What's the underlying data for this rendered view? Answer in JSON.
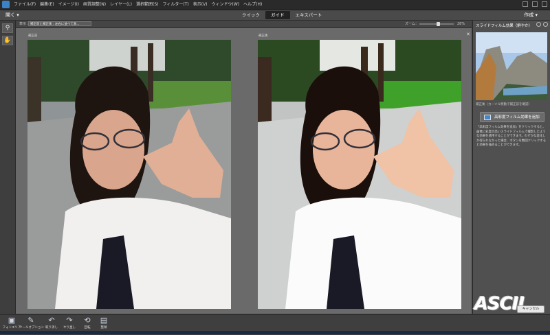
{
  "menu": {
    "items": [
      "ファイル(F)",
      "編集(E)",
      "イメージ(I)",
      "画質調整(N)",
      "レイヤー(L)",
      "選択範囲(S)",
      "フィルター(T)",
      "表示(V)",
      "ウィンドウ(W)",
      "ヘルプ(H)"
    ]
  },
  "modebar": {
    "open_label": "開く",
    "tabs": [
      "クイック",
      "ガイド",
      "エキスパート"
    ],
    "active_tab": "ガイド",
    "create_label": "作成"
  },
  "options": {
    "view_label": "表示：",
    "view_value": "補正前と補正後 : 左右に並べて表...",
    "zoom_label": "ズーム：",
    "zoom_value": "28%"
  },
  "canvas": {
    "before_label": "補正前",
    "after_label": "補正後",
    "close_icon": "close-icon"
  },
  "panel": {
    "title": "スライドフィルム効果（鮮やか）",
    "thumb_caption": "補正後（カーソル移動で補正前を確認）",
    "add_button_label": "高彩度フィルム効果を追加",
    "description": "「高彩度フィルム効果を追加」をクリックすると、画像に彩度の高いスライドフィルムで撮影したような効果を適用することができます。わずかな変化しか得られなかった場合、ボタンを数回クリックすると効果を強めることができます。",
    "cancel_label": "キャンセル"
  },
  "watermark": "ASCII",
  "bottom": {
    "items": [
      {
        "label": "フォトエリア",
        "icon": "photo-bin-icon"
      },
      {
        "label": "ツールオプション",
        "icon": "tool-options-icon"
      },
      {
        "label": "取り消し",
        "icon": "undo-icon"
      },
      {
        "label": "やり直し",
        "icon": "redo-icon"
      },
      {
        "label": "回転",
        "icon": "rotate-icon"
      },
      {
        "label": "整頓",
        "icon": "organize-icon"
      }
    ]
  },
  "colors": {
    "menubar": "#2a2a2a",
    "workspace": "#3b3b3b",
    "canvas": "#6a6a6a",
    "panel": "#505050",
    "accent_blue": "#4a86c6"
  }
}
